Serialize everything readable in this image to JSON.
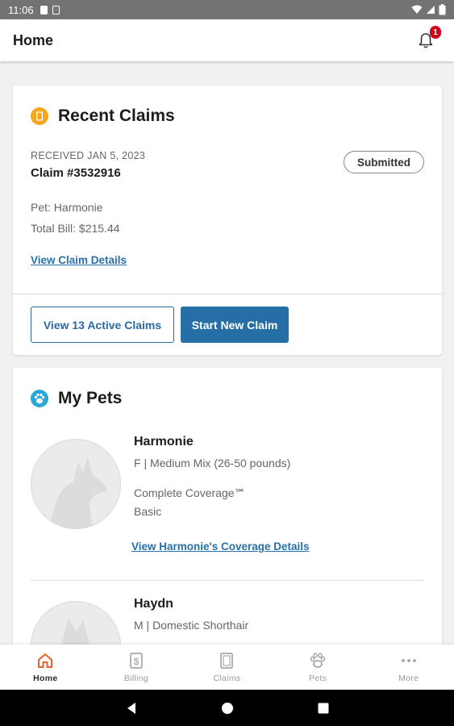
{
  "status_bar": {
    "time": "11:06"
  },
  "app_bar": {
    "title": "Home",
    "notification_count": "1"
  },
  "recent_claims": {
    "title": "Recent Claims",
    "received": "RECEIVED JAN 5, 2023",
    "claim_number": "Claim #3532916",
    "status": "Submitted",
    "pet": "Pet: Harmonie",
    "total_bill": "Total Bill: $215.44",
    "details_link": "View Claim Details",
    "active_claims_button": "View 13 Active Claims",
    "new_claim_button": "Start New Claim"
  },
  "my_pets": {
    "title": "My Pets",
    "pets": [
      {
        "name": "Harmonie",
        "description": "F | Medium Mix (26-50 pounds)",
        "coverage": "Complete Coverage℠",
        "plan": "Basic",
        "coverage_link": "View Harmonie's Coverage Details"
      },
      {
        "name": "Haydn",
        "description": "M | Domestic Shorthair"
      }
    ]
  },
  "bottom_nav": [
    {
      "label": "Home",
      "icon": "home-icon",
      "active": true
    },
    {
      "label": "Billing",
      "icon": "dollar-icon",
      "active": false
    },
    {
      "label": "Claims",
      "icon": "document-icon",
      "active": false
    },
    {
      "label": "Pets",
      "icon": "paw-icon",
      "active": false
    },
    {
      "label": "More",
      "icon": "more-dots-icon",
      "active": false
    }
  ],
  "colors": {
    "brand_blue": "#266fa6",
    "active_orange": "#e8622a",
    "badge_red": "#d0021b",
    "claims_icon_amber": "#f4a71d",
    "pets_icon_teal": "#2aa8d8"
  }
}
